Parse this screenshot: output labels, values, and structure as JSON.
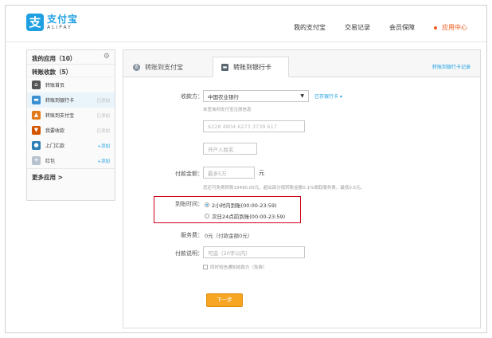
{
  "header": {
    "logo_cn": "支付宝",
    "logo_en": "ALIPAY",
    "logo_mark": "支",
    "nav": [
      "我的支付宝",
      "交易记录",
      "会员保障"
    ],
    "nav_active": "应用中心"
  },
  "sidebar": {
    "my_apps": "我的应用（10）",
    "transfer_group": "转账收款（5）",
    "items": [
      {
        "label": "转账首页",
        "tag": "",
        "icon": "home-icon"
      },
      {
        "label": "转账到银行卡",
        "tag": "已添加",
        "icon": "bank-card-icon"
      },
      {
        "label": "转账到支付宝",
        "tag": "已添加",
        "icon": "alipay-icon"
      },
      {
        "label": "我要收款",
        "tag": "已添加",
        "icon": "receive-icon"
      },
      {
        "label": "上门汇款",
        "tag": "+添加",
        "icon": "remit-icon"
      },
      {
        "label": "红包",
        "tag": "+添加",
        "icon": "redpacket-icon"
      }
    ],
    "more": "更多应用 >"
  },
  "tabs": {
    "tab1": "转账到支付宝",
    "tab2": "转账到银行卡",
    "record_link": "转账到银行卡记录"
  },
  "form": {
    "payee_label": "收款方：",
    "bank_value": "中国农业银行",
    "bank_link": "已存银行卡 ▾",
    "bank_hint": "未查询到支付宝注册信息",
    "card_number": "6228 4804 6273 3739 617",
    "name_placeholder": "开户人姓名",
    "amount_label": "付款金额：",
    "amount_placeholder": "最多5万",
    "amount_unit": "元",
    "amount_hint": "您还可免费转账19490.00元，超出部分按转账金额0.1%收取服务费，最低0.5元。",
    "arrive_label": "到账时间：",
    "arrive_opt1": "2小时内到账(00:00-23:59)",
    "arrive_opt2": "次日24点前到账(00:00-23:59)",
    "fee_label": "服务费：",
    "fee_value": "0元（付款金额0元）",
    "note_label": "付款说明：",
    "note_placeholder": "可选（20字以内）",
    "sms_check": "同时短信通知收款方（免费）",
    "next_button": "下一步"
  },
  "colors": {
    "brand": "#1d9fe2",
    "accent": "#f05a1a",
    "highlight": "#d0021b",
    "button": "#f6a623"
  }
}
